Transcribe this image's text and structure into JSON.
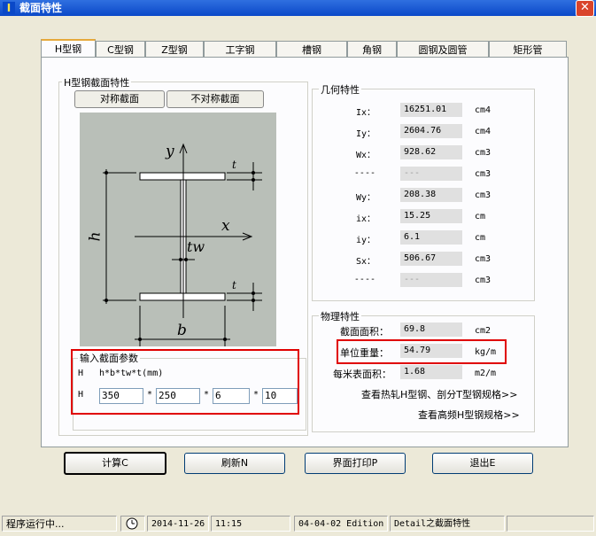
{
  "window": {
    "title": "截面特性",
    "icon": "I"
  },
  "tabs": [
    "H型钢",
    "C型钢",
    "Z型钢",
    "工字钢",
    "槽钢",
    "角钢",
    "圆钢及圆管",
    "矩形管"
  ],
  "section_group": {
    "title": "H型钢截面特性",
    "sym_button": "对称截面",
    "asym_button": "不对称截面"
  },
  "diagram": {
    "y": "y",
    "x": "x",
    "t": "t",
    "tw": "tw",
    "h": "h",
    "b": "b"
  },
  "geometry": {
    "title": "几何特性",
    "rows": [
      {
        "label": "Ix：",
        "value": "16251.01",
        "unit": "cm4"
      },
      {
        "label": "Iy：",
        "value": "2604.76",
        "unit": "cm4"
      },
      {
        "label": "Wx：",
        "value": "928.62",
        "unit": "cm3"
      },
      {
        "label": "----",
        "value": "---",
        "unit": "cm3"
      },
      {
        "label": "Wy：",
        "value": "208.38",
        "unit": "cm3"
      },
      {
        "label": "ix：",
        "value": "15.25",
        "unit": "cm"
      },
      {
        "label": "iy：",
        "value": "6.1",
        "unit": "cm"
      },
      {
        "label": "Sx：",
        "value": "506.67",
        "unit": "cm3"
      },
      {
        "label": "----",
        "value": "---",
        "unit": "cm3"
      }
    ]
  },
  "physical": {
    "title": "物理特性",
    "area_label": "截面面积：",
    "area_value": "69.8",
    "area_unit": "cm2",
    "weight_label": "单位重量：",
    "weight_value": "54.79",
    "weight_unit": "kg/m",
    "surface_label": "每米表面积：",
    "surface_value": "1.68",
    "surface_unit": "m2/m",
    "link1": "查看热轧H型钢、剖分T型钢规格>>",
    "link2": "查看高频H型钢规格>>"
  },
  "input": {
    "title": "输入截面参数",
    "param_code": "H",
    "param_format": "h*b*tw*t(mm)",
    "row_code": "H",
    "values": [
      "350",
      "250",
      "6",
      "10"
    ],
    "sep": "*"
  },
  "buttons": {
    "calc": "计算C",
    "refresh": "刷新N",
    "print": "界面打印P",
    "exit": "退出E"
  },
  "status": {
    "running": "程序运行中...",
    "date": "2014-11-26",
    "time": "11:15",
    "edition": "04-04-02 Edition",
    "module": "Detail之截面特性"
  },
  "colors": {
    "highlight_box": "#e00000",
    "title_bar": "#0a48c8",
    "diagram_bg": "#b9bfb8"
  }
}
